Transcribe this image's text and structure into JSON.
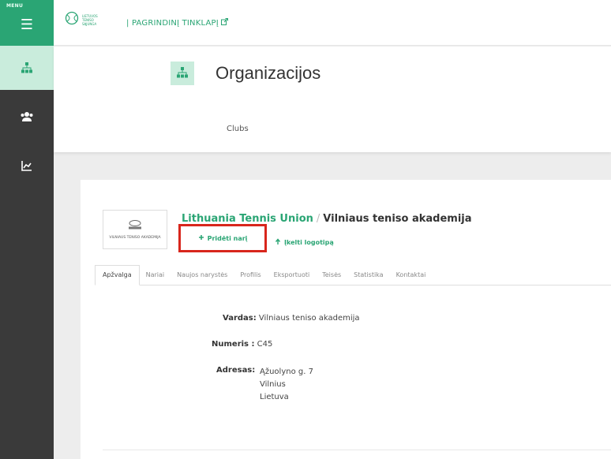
{
  "sidebar": {
    "menu_label": "MENU",
    "items": [
      {
        "icon": "sitemap-icon",
        "active": true
      },
      {
        "icon": "users-icon",
        "active": false
      },
      {
        "icon": "chart-icon",
        "active": false
      }
    ]
  },
  "topbar": {
    "logo_text": "LIETUVOS TENISO SĄJUNGA",
    "home_link": "| PAGRINDINĮ TINKLAPĮ"
  },
  "header": {
    "title": "Organizacijos",
    "subtitle": "Clubs"
  },
  "card": {
    "club_logo_text": "VILNIAUS TENISO AKADEMIJA",
    "breadcrumb": {
      "parent": "Lithuania Tennis Union",
      "separator": "/",
      "current": "Vilniaus teniso akademija"
    },
    "add_member_label": "Pridėti narį",
    "upload_logo_label": "Įkelti logotipą",
    "tabs": [
      "Apžvalga",
      "Nariai",
      "Naujos narystės",
      "Profilis",
      "Eksportuoti",
      "Teisės",
      "Statistika",
      "Kontaktai"
    ],
    "fields": {
      "name_label": "Vardas:",
      "name_value": "Vilniaus teniso akademija",
      "number_label": "Numeris :",
      "number_value": "C45",
      "address_label": "Adresas:",
      "address_lines": [
        "Ąžuolyno g. 7",
        "Vilnius",
        "Lietuva"
      ]
    }
  },
  "colors": {
    "accent": "#2aa574",
    "accent_light": "#c9ecdc",
    "sidebar_bg": "#3a3a3a",
    "highlight_border": "#d8261c"
  }
}
